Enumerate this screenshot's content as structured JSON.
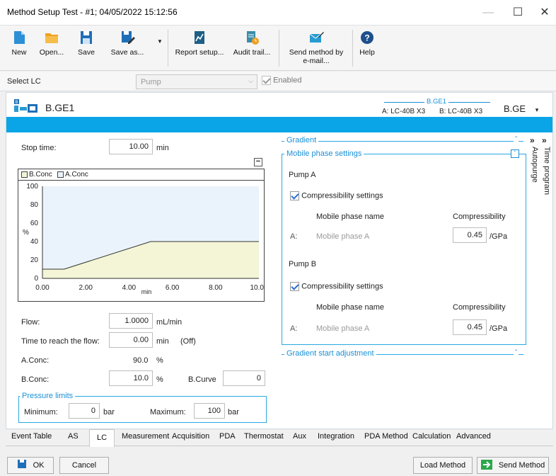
{
  "window": {
    "title": "Method Setup Test - #1;  04/05/2022  15:12:56",
    "minimize": "—",
    "maximize": "☐",
    "close": "✕"
  },
  "toolbar": {
    "new": "New",
    "open": "Open...",
    "save": "Save",
    "save_as": "Save as...",
    "report_setup": "Report setup...",
    "audit_trail": "Audit trail...",
    "send_method_line1": "Send method by",
    "send_method_line2": "e-mail...",
    "help": "Help",
    "colors": {
      "new": "#2d8fd5",
      "open": "#f0a020",
      "save": "#1f6fb8",
      "saveas": "#1f6fb8",
      "report": "#1e5f86",
      "audit": "#3b8ca8",
      "send": "#2a9bd1",
      "help": "#1d4f8c"
    }
  },
  "select_lc": {
    "label": "Select LC",
    "value": "Pump",
    "enabled_label": "Enabled"
  },
  "unit": {
    "name": "B.GE1",
    "group_label": "B.GE1",
    "pump_a": "A: LC-40B X3",
    "pump_b": "B: LC-40B X3",
    "selector": "B.GE",
    "accent": "#0aa5e6"
  },
  "left": {
    "stop_time_label": "Stop time:",
    "stop_time_value": "10.00",
    "stop_time_unit": "min",
    "legend_b": "B.Conc",
    "legend_a": "A.Conc",
    "flow_label": "Flow:",
    "flow_value": "1.0000",
    "flow_unit": "mL/min",
    "ttf_label": "Time to reach the flow:",
    "ttf_value": "0.00",
    "ttf_unit": "min",
    "ttf_note": "(Off)",
    "aconc_label": "A.Conc:",
    "aconc_value": "90.0",
    "aconc_unit": "%",
    "bconc_label": "B.Conc:",
    "bconc_value": "10.0",
    "bconc_unit": "%",
    "bcurve_label": "B.Curve",
    "bcurve_value": "0",
    "pressure_title": "Pressure limits",
    "min_label": "Minimum:",
    "min_value": "0",
    "min_unit": "bar",
    "max_label": "Maximum:",
    "max_value": "100",
    "max_unit": "bar"
  },
  "chart_data": {
    "type": "area",
    "xlabel": "min",
    "ylabel": "%",
    "xlim": [
      0,
      10
    ],
    "ylim": [
      0,
      100
    ],
    "x_ticks": [
      "0.00",
      "2.00",
      "4.00",
      "6.00",
      "8.00",
      "10.00"
    ],
    "y_ticks": [
      "0",
      "20",
      "40",
      "60",
      "80",
      "100"
    ],
    "series": [
      {
        "name": "B.Conc",
        "color": "#f3f5d6",
        "points": [
          [
            0,
            10
          ],
          [
            1,
            10
          ],
          [
            5,
            40
          ],
          [
            10,
            40
          ]
        ]
      },
      {
        "name": "A.Conc",
        "color": "#eaf3fb",
        "points": [
          [
            0,
            90
          ],
          [
            1,
            90
          ],
          [
            5,
            60
          ],
          [
            10,
            60
          ]
        ]
      }
    ]
  },
  "right": {
    "gradient_title": "Gradient",
    "mobile_title": "Mobile phase settings",
    "pump_a_title": "Pump A",
    "pump_b_title": "Pump B",
    "comp_settings": "Compressibility settings",
    "mp_name_header": "Mobile phase name",
    "comp_header": "Compressibility",
    "row_a_label": "A:",
    "row_a_name": "Mobile phase A",
    "row_a_value": "0.45",
    "row_b_label": "A:",
    "row_b_name": "Mobile phase A",
    "row_b_value": "0.45",
    "unit_gpa": "/GPa",
    "gsa_title": "Gradient start adjustment",
    "side_time_program": "Time program",
    "side_autopurge": "Autopurge"
  },
  "tabs": [
    "Event Table",
    "AS",
    "LC",
    "Measurement",
    "Acquisition",
    "PDA",
    "Thermostat",
    "Aux",
    "Integration",
    "PDA Method",
    "Calculation",
    "Advanced"
  ],
  "footer": {
    "ok": "OK",
    "cancel": "Cancel",
    "load_method": "Load Method",
    "send_method": "Send Method"
  }
}
